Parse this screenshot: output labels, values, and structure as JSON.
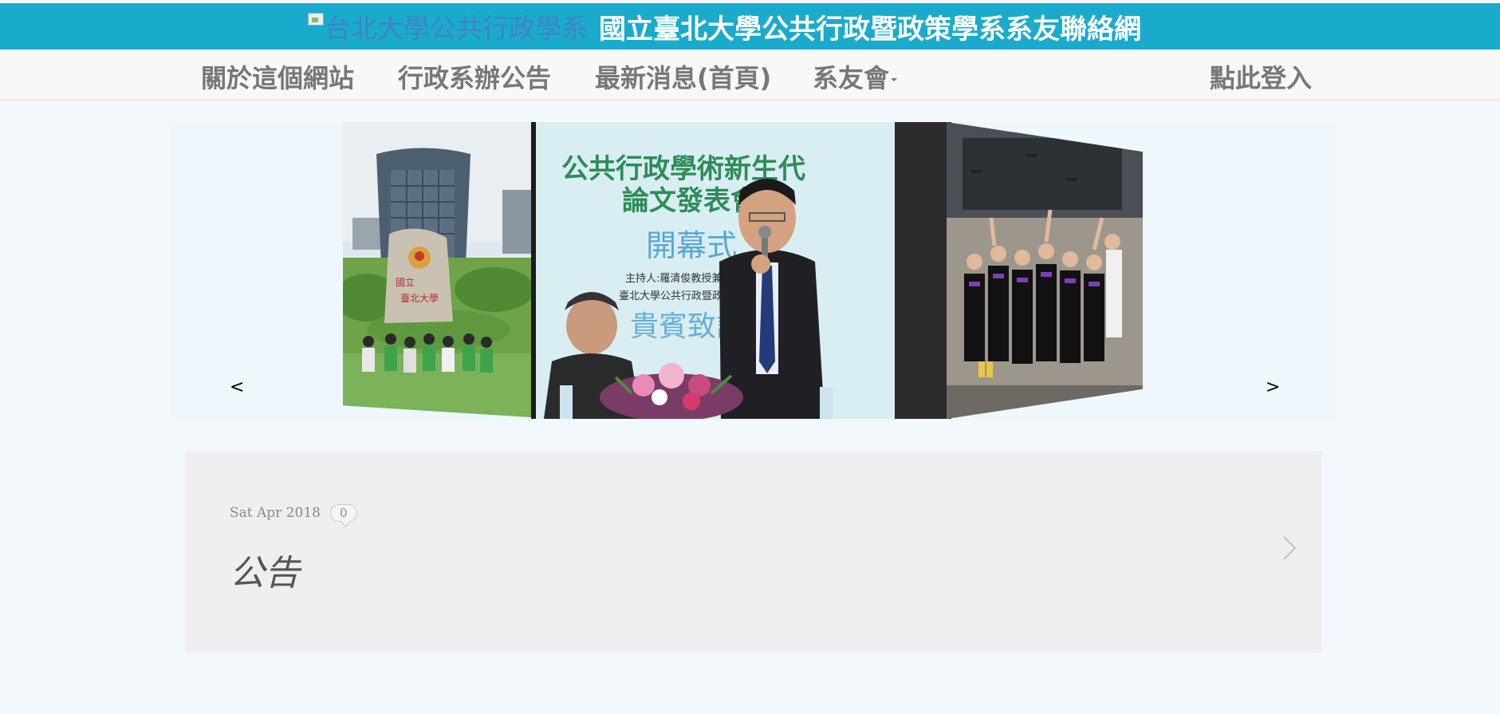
{
  "header": {
    "logo_alt": "台北大學公共行政學系",
    "title": "國立臺北大學公共行政暨政策學系系友聯絡網",
    "bg_color": "#1aabcc"
  },
  "nav": {
    "items": [
      {
        "label": "關於這個網站"
      },
      {
        "label": "行政系辦公告"
      },
      {
        "label": "最新消息(首頁)"
      },
      {
        "label": "系友會",
        "dropdown": true
      }
    ],
    "login_label": "點此登入"
  },
  "carousel": {
    "prev_label": "<",
    "next_label": ">",
    "slides": [
      {
        "description": "campus-building-group-photo"
      },
      {
        "banner_line1": "公共行政學術新生代",
        "banner_line2": "論文發表會",
        "banner_line3": "開幕式",
        "banner_line4": "主持人:羅清俊教授兼系",
        "banner_line5": "臺北大學公共行政暨政",
        "banner_line6": "貴賓致詞"
      },
      {
        "description": "graduation-group-photo"
      }
    ]
  },
  "post": {
    "date": "Sat Apr 2018",
    "comment_count": "0",
    "title": "公告"
  }
}
